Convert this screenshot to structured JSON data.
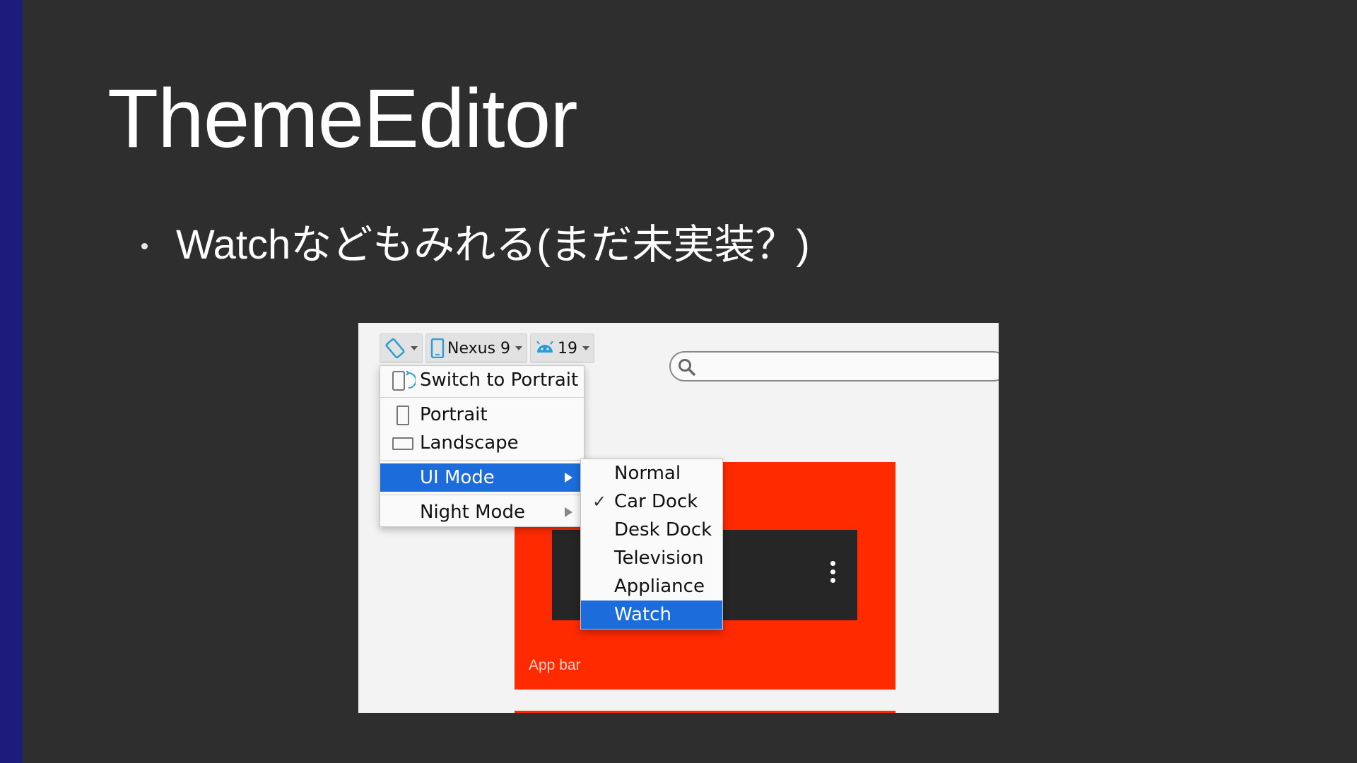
{
  "slide": {
    "title": "ThemeEditor",
    "bullet": "Watchなどもみれる(まだ未実装？)",
    "accent_color": "#1c1c7a",
    "background_color": "#2e2e2f"
  },
  "screenshot": {
    "toolbar": {
      "orientation_icon": "rotate-device-icon",
      "device_label": "Nexus 9",
      "api_level": "19"
    },
    "search": {
      "placeholder": "",
      "value": ""
    },
    "menu": {
      "switch_label": "Switch to Portrait",
      "portrait_label": "Portrait",
      "landscape_label": "Landscape",
      "ui_mode_label": "UI Mode",
      "night_mode_label": "Night Mode"
    },
    "ui_mode_submenu": {
      "items": [
        "Normal",
        "Car Dock",
        "Desk Dock",
        "Television",
        "Appliance",
        "Watch"
      ],
      "checked": "Car Dock",
      "highlighted": "Watch"
    },
    "preview": {
      "app_bar_label": "App bar",
      "app_bar_color": "#ff2a00",
      "toolbar_color": "#262626"
    },
    "selection_color": "#1c6ddb"
  }
}
